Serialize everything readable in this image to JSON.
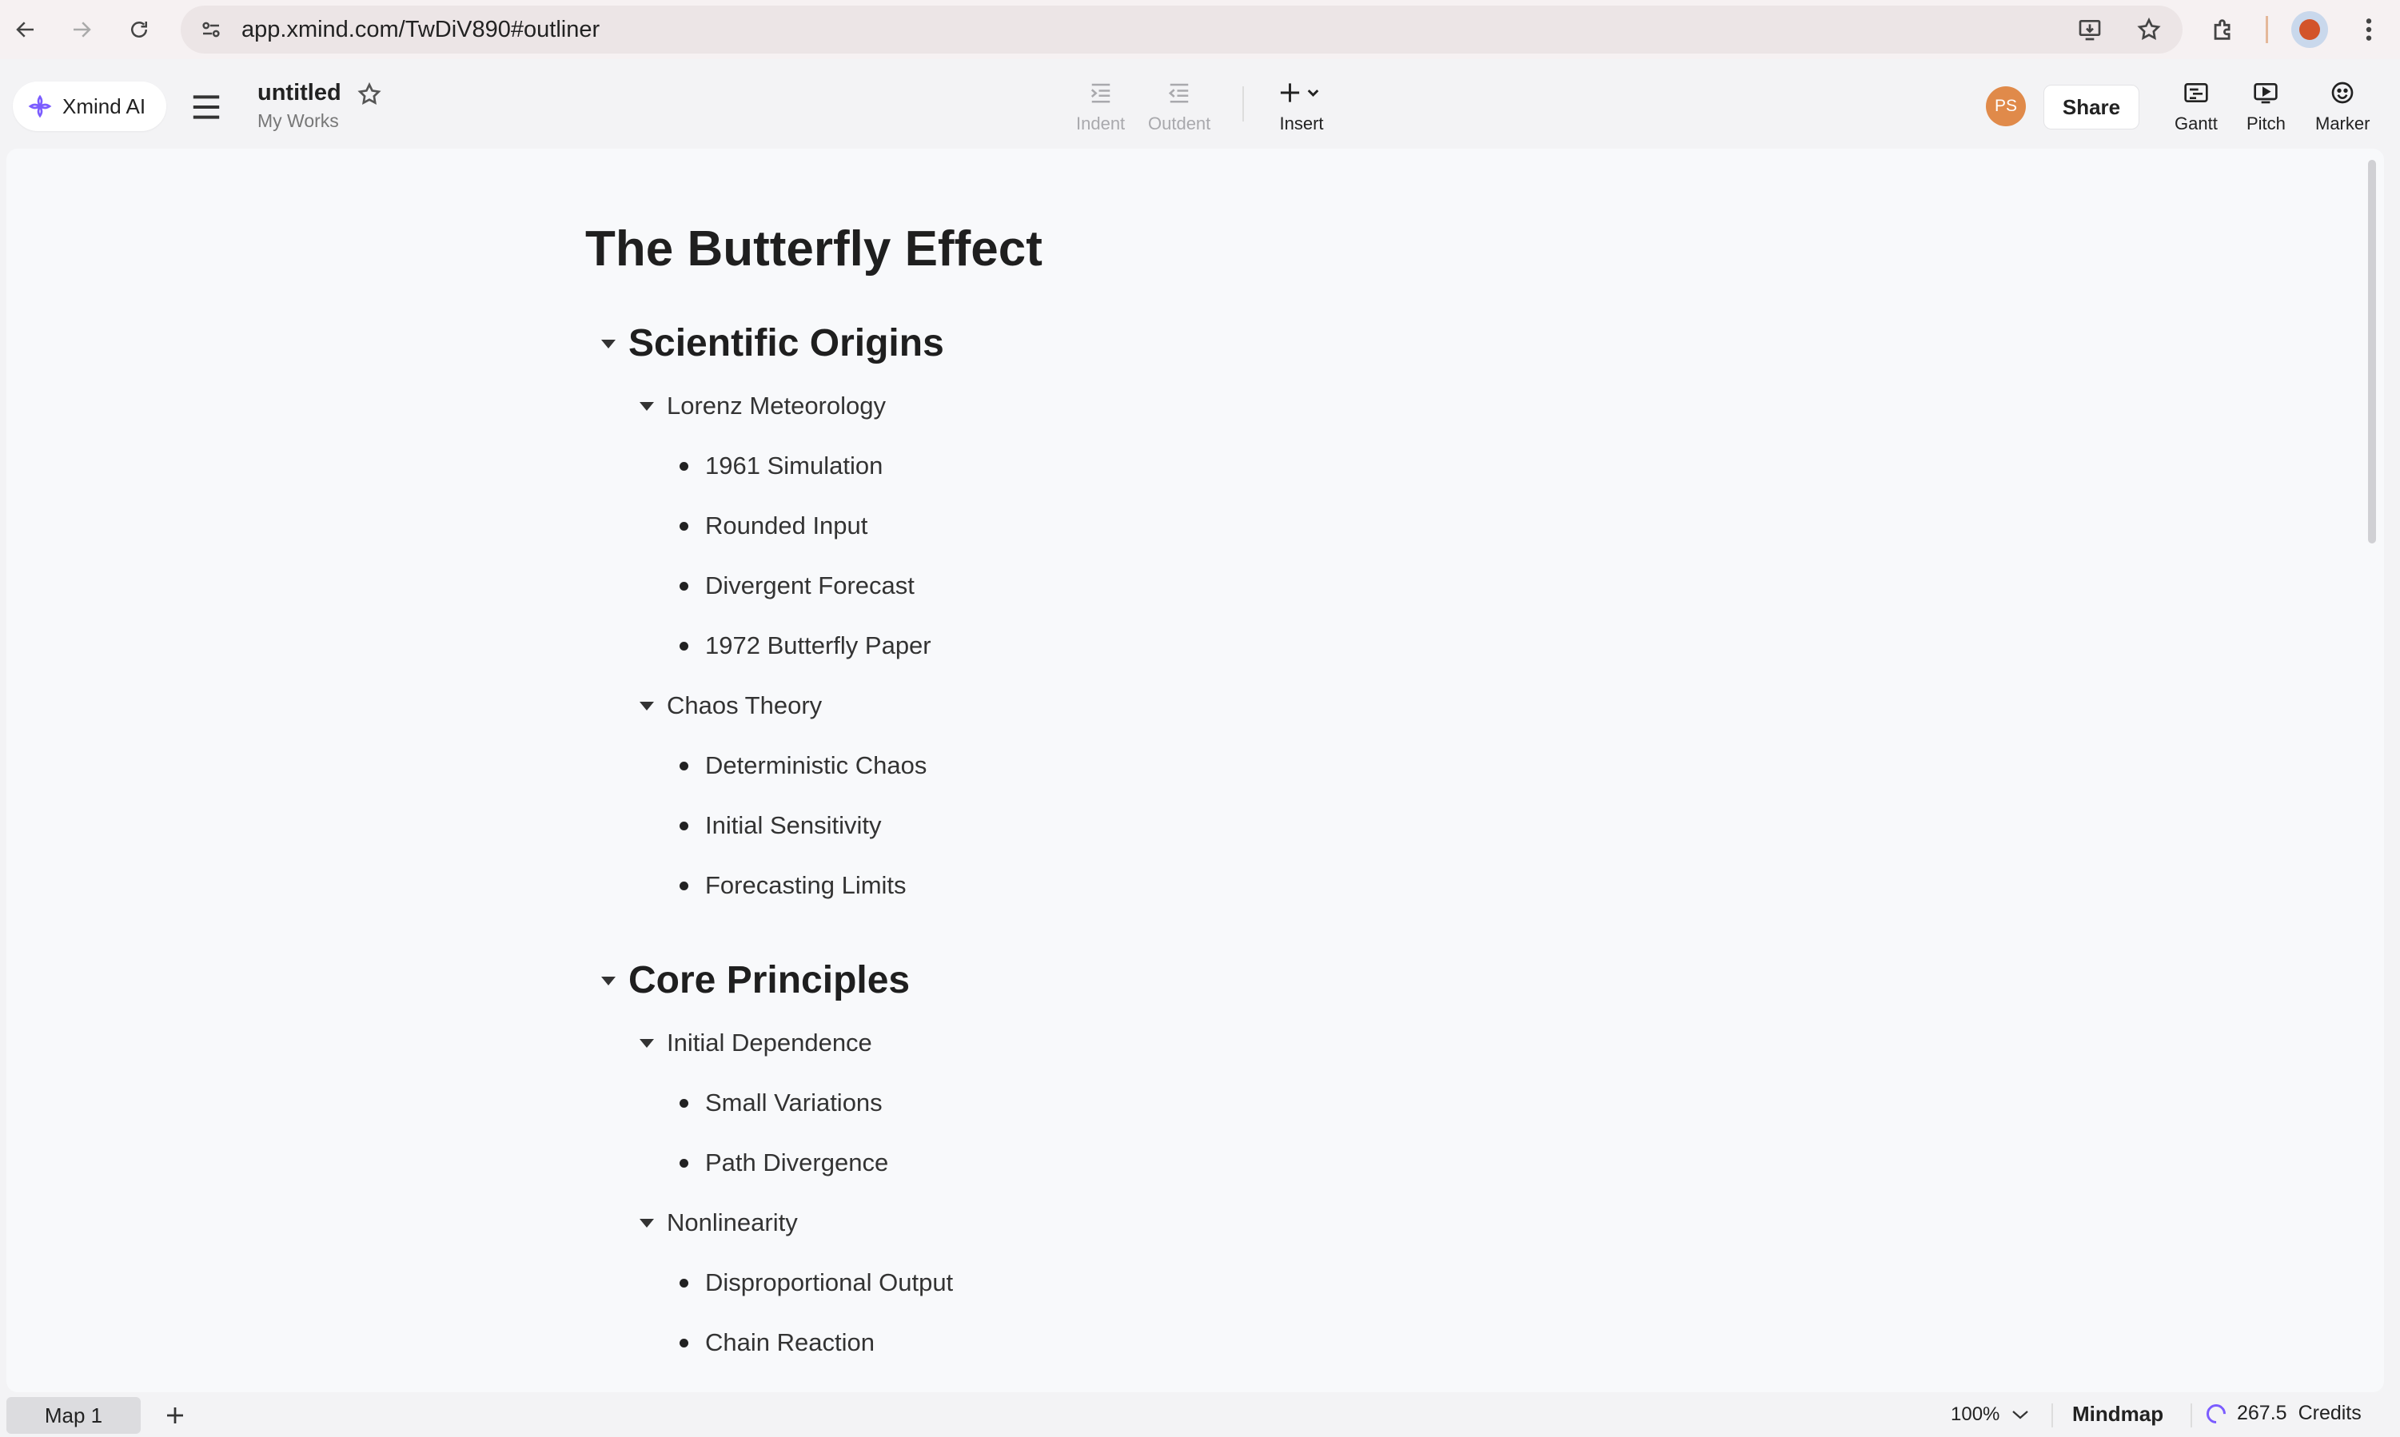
{
  "browser": {
    "url": "app.xmind.com/TwDiV890#outliner"
  },
  "toolbar": {
    "ai_label": "Xmind AI",
    "doc_title": "untitled",
    "doc_subtitle": "My Works",
    "indent_label": "Indent",
    "outdent_label": "Outdent",
    "insert_label": "Insert",
    "avatar_initials": "PS",
    "share_label": "Share",
    "gantt_label": "Gantt",
    "pitch_label": "Pitch",
    "marker_label": "Marker"
  },
  "outline": {
    "title": "The Butterfly Effect",
    "sections": [
      {
        "label": "Scientific Origins",
        "groups": [
          {
            "label": "Lorenz Meteorology",
            "items": [
              "1961 Simulation",
              "Rounded Input",
              "Divergent Forecast",
              "1972 Butterfly Paper"
            ]
          },
          {
            "label": "Chaos Theory",
            "items": [
              "Deterministic Chaos",
              "Initial Sensitivity",
              "Forecasting Limits"
            ]
          }
        ]
      },
      {
        "label": "Core Principles",
        "groups": [
          {
            "label": "Initial Dependence",
            "items": [
              "Small Variations",
              "Path Divergence"
            ]
          },
          {
            "label": "Nonlinearity",
            "items": [
              "Disproportional Output",
              "Chain Reaction"
            ]
          }
        ]
      }
    ]
  },
  "status": {
    "sheet_tab": "Map 1",
    "zoom": "100%",
    "view_mode": "Mindmap",
    "credits_value": "267.5",
    "credits_label": "Credits"
  },
  "colors": {
    "accent": "#7b5cff",
    "avatar": "#e08a4a",
    "canvas": "#f8f9fb"
  }
}
